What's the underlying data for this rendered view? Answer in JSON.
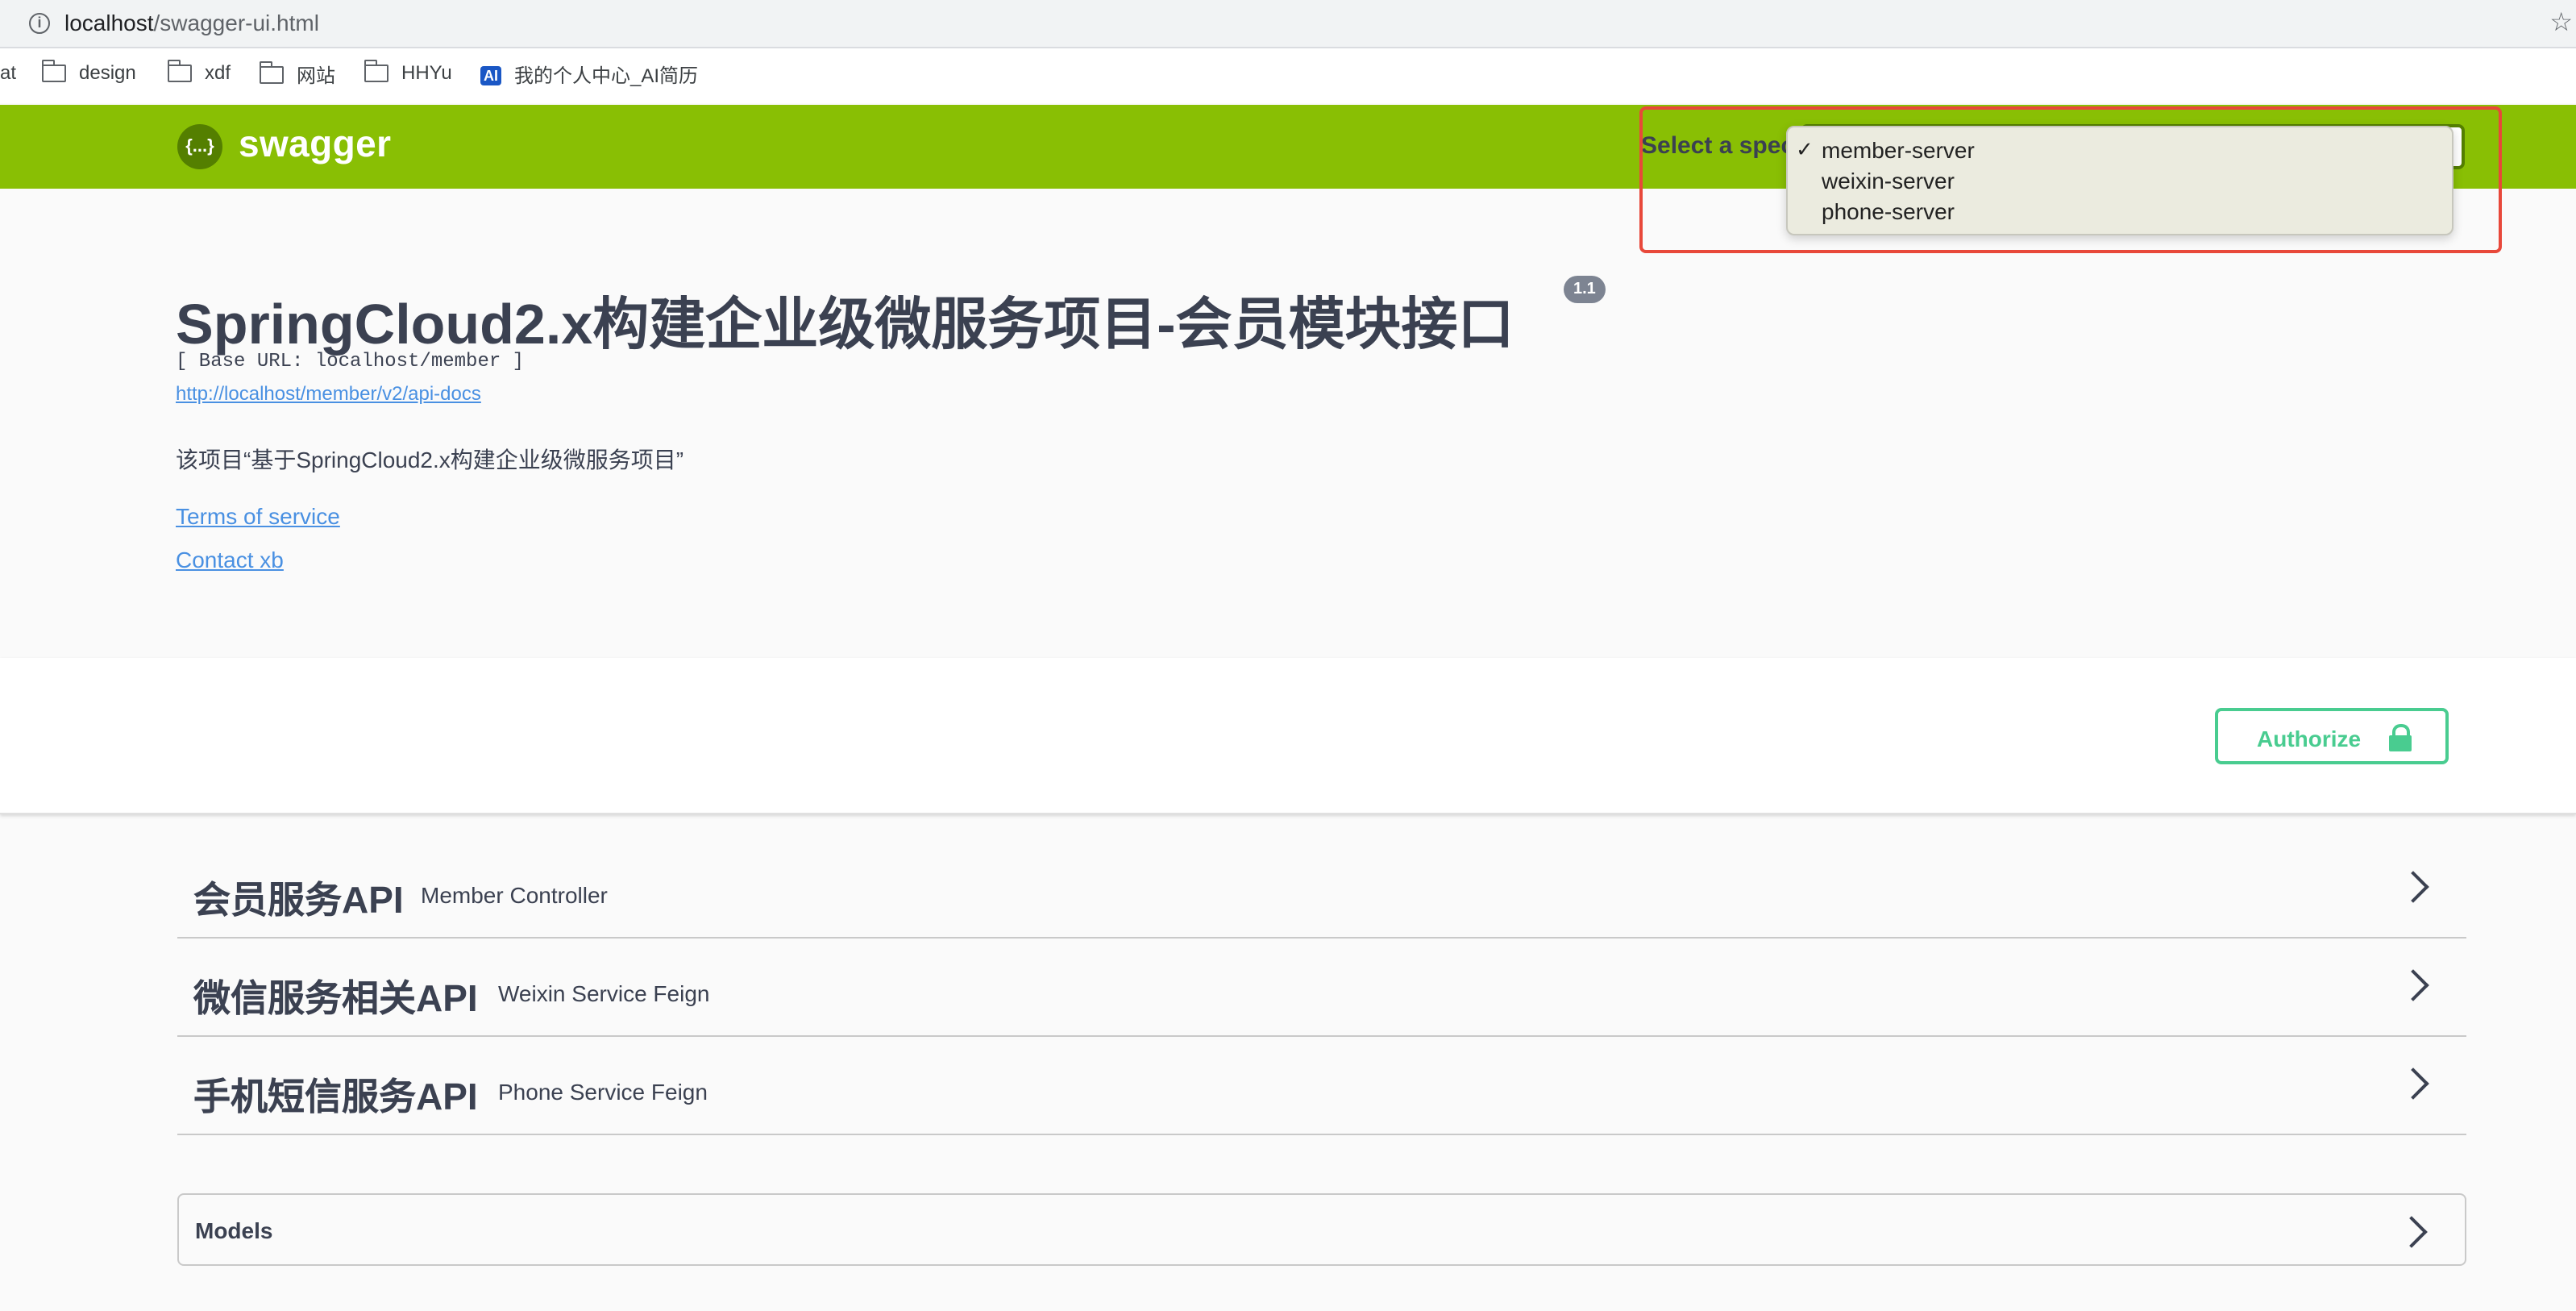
{
  "browser": {
    "url_host": "localhost",
    "url_path": "/swagger-ui.html",
    "bookmarks": [
      {
        "label": "at",
        "icon": "none"
      },
      {
        "label": "design",
        "icon": "folder-icon"
      },
      {
        "label": "xdf",
        "icon": "folder-icon"
      },
      {
        "label": "网站",
        "icon": "folder-icon"
      },
      {
        "label": "HHYu",
        "icon": "folder-icon"
      },
      {
        "label": "我的个人中心_AI简历",
        "icon": "ai-badge",
        "badge_text": "AI"
      }
    ]
  },
  "topbar": {
    "logo_symbol": "{...}",
    "logo_text": "swagger",
    "spec_label": "Select a spec",
    "spec_options": [
      {
        "label": "member-server",
        "selected": true
      },
      {
        "label": "weixin-server",
        "selected": false
      },
      {
        "label": "phone-server",
        "selected": false
      }
    ],
    "check_mark": "✓"
  },
  "info": {
    "title": "SpringCloud2.x构建企业级微服务项目-会员模块接口",
    "version": "1.1",
    "base_url": "[ Base URL: localhost/member ]",
    "api_docs_link": "http://localhost/member/v2/api-docs",
    "description": "该项目“基于SpringCloud2.x构建企业级微服务项目”",
    "terms_link": "Terms of service",
    "contact_link": "Contact xb"
  },
  "scheme": {
    "authorize_label": "Authorize"
  },
  "tags": [
    {
      "name": "会员服务API",
      "description": "Member Controller"
    },
    {
      "name": "微信服务相关API",
      "description": "Weixin Service Feign"
    },
    {
      "name": "手机短信服务API",
      "description": "Phone Service Feign"
    }
  ],
  "models": {
    "label": "Models"
  },
  "colors": {
    "topbar_bg": "#89bf04",
    "authorize": "#49cc90",
    "link": "#4990e2",
    "highlight_box": "#e8483a"
  }
}
